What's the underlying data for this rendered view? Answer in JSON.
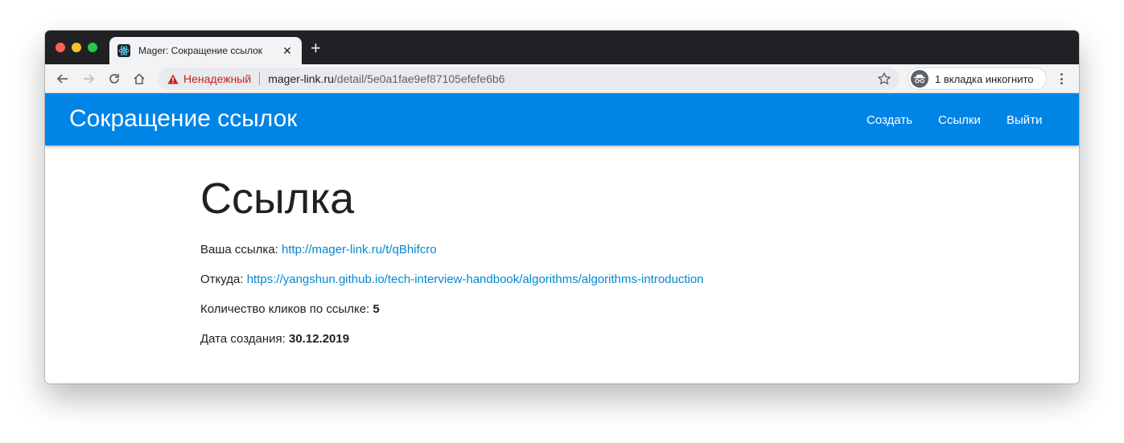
{
  "browser": {
    "tab_title": "Mager: Сокращение ссылок",
    "tab_close": "✕",
    "new_tab": "+",
    "security_label": "Ненадежный",
    "url_host": "mager-link.ru",
    "url_path": "/detail/5e0a1fae9ef87105efefe6b6",
    "incognito_label": "1 вкладка инкогнито"
  },
  "app": {
    "brand": "Сокращение ссылок",
    "nav": [
      "Создать",
      "Ссылки",
      "Выйти"
    ]
  },
  "detail": {
    "title": "Ссылка",
    "short_label": "Ваша ссылка:",
    "short_url": "http://mager-link.ru/t/qBhifcro",
    "from_label": "Откуда:",
    "from_url": "https://yangshun.github.io/tech-interview-handbook/algorithms/algorithms-introduction",
    "clicks_label": "Количество кликов по ссылке:",
    "clicks_value": "5",
    "date_label": "Дата создания:",
    "date_value": "30.12.2019"
  },
  "colors": {
    "appbar": "#0084e6",
    "link": "#0288d1",
    "warning": "#c5221f"
  },
  "icons": [
    "back-icon",
    "forward-icon",
    "reload-icon",
    "home-icon",
    "warning-icon",
    "star-icon",
    "incognito-icon",
    "menu-icon",
    "react-favicon-icon"
  ]
}
